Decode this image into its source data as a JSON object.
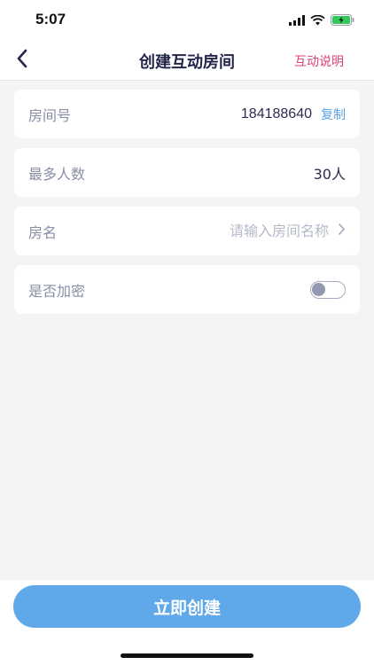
{
  "status_bar": {
    "time": "5:07",
    "icons": [
      "signal-icon",
      "wifi-icon",
      "battery-charging-icon"
    ],
    "battery_color": "#34c759"
  },
  "nav": {
    "back_icon": "chevron-left-icon",
    "title": "创建互动房间",
    "help_label": "互动说明",
    "help_color": "#e0417a"
  },
  "form": {
    "room_number": {
      "label": "房间号",
      "value": "184188640",
      "copy_label": "复制"
    },
    "max_people": {
      "label": "最多人数",
      "value": "30人"
    },
    "room_name": {
      "label": "房名",
      "value": "",
      "placeholder": "请输入房间名称",
      "arrow_icon": "chevron-right-icon"
    },
    "encrypt": {
      "label": "是否加密",
      "enabled": false
    }
  },
  "footer": {
    "create_label": "立即创建",
    "button_color": "#5fa9ea"
  }
}
